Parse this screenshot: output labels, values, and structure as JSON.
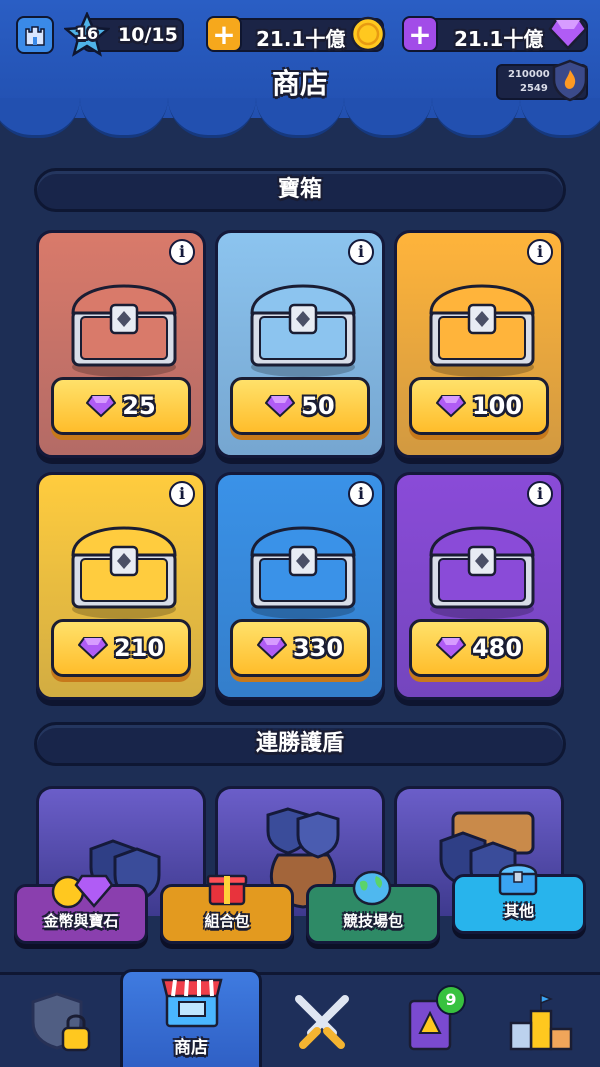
{
  "header": {
    "title": "商店",
    "level": "16",
    "xp": "10/15",
    "coins": "21.1十億",
    "gems": "21.1十億",
    "trophy_primary": "210000",
    "trophy_secondary": "2549"
  },
  "sections": {
    "chests_title": "寶箱",
    "shields_title": "連勝護盾"
  },
  "chests": [
    {
      "price": "25",
      "theme": "#d97a6a"
    },
    {
      "price": "50",
      "theme": "#8cc4ef"
    },
    {
      "price": "100",
      "theme": "#ffb43b"
    },
    {
      "price": "210",
      "theme": "#ffcc3e"
    },
    {
      "price": "330",
      "theme": "#3a92e8"
    },
    {
      "price": "480",
      "theme": "#8a4bd8"
    }
  ],
  "categories": [
    {
      "label": "金幣與寶石",
      "color": "#8a3fae"
    },
    {
      "label": "組合包",
      "color": "#e39a1f"
    },
    {
      "label": "競技場包",
      "color": "#2e8a66"
    },
    {
      "label": "其他",
      "color": "#28b4ec"
    }
  ],
  "nav": {
    "shop_label": "商店",
    "book_badge": "9"
  },
  "colors": {
    "accent_blue": "#2250b0",
    "gem_purple": "#9b4dff",
    "coin_yellow": "#ffc81f"
  }
}
